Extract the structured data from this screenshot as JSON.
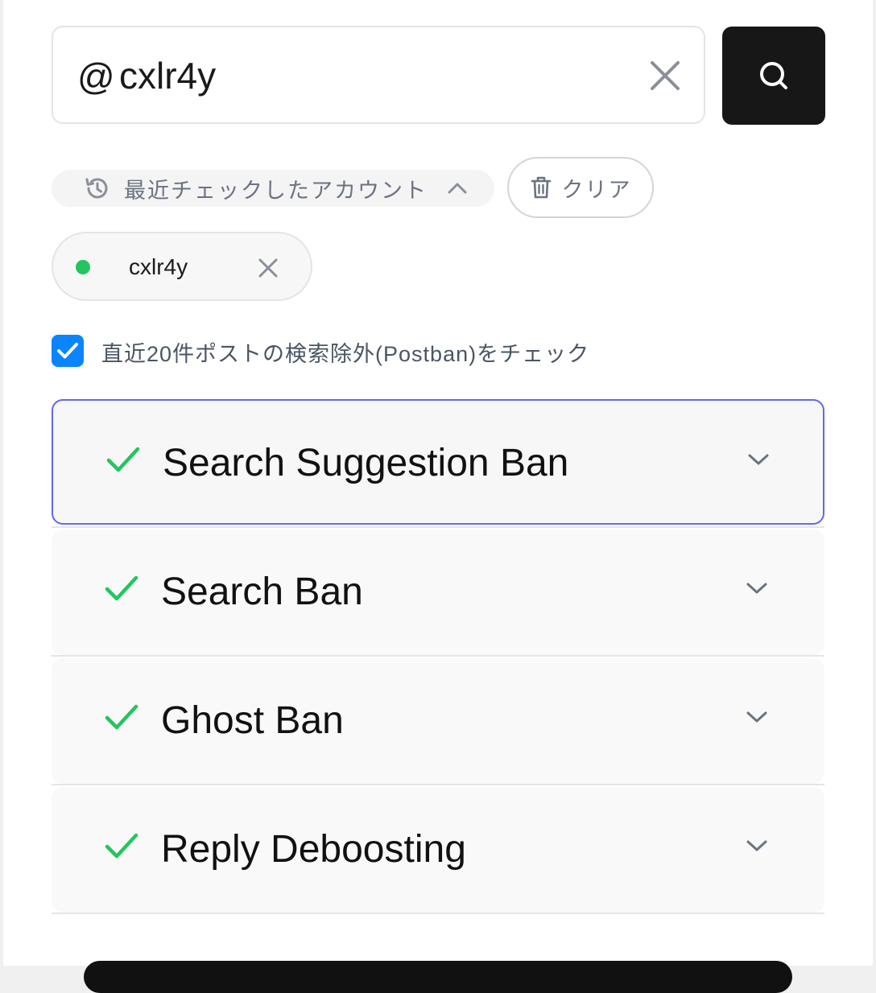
{
  "search": {
    "prefix": "@",
    "value": "cxlr4y",
    "placeholder": ""
  },
  "recent": {
    "label": "最近チェックしたアカウント",
    "clear_label": "クリア",
    "accounts": [
      {
        "name": "cxlr4y",
        "status_color": "#22c55e"
      }
    ]
  },
  "postban_check": {
    "checked": true,
    "label": "直近20件ポストの検索除外(Postban)をチェック"
  },
  "results": [
    {
      "title": "Search Suggestion Ban",
      "status": "pass"
    },
    {
      "title": "Search Ban",
      "status": "pass"
    },
    {
      "title": "Ghost Ban",
      "status": "pass"
    },
    {
      "title": "Reply Deboosting",
      "status": "pass"
    }
  ],
  "colors": {
    "accent": "#0a84ff",
    "pass": "#22c55e",
    "focus_border": "#6366f1",
    "primary_button": "#171717"
  },
  "icons": {
    "search_button": "search-icon",
    "clear_input": "close-icon",
    "recent": "history-icon",
    "clear_history": "trash-icon",
    "result_status": "checkmark-icon",
    "expand": "chevron-down-icon"
  }
}
